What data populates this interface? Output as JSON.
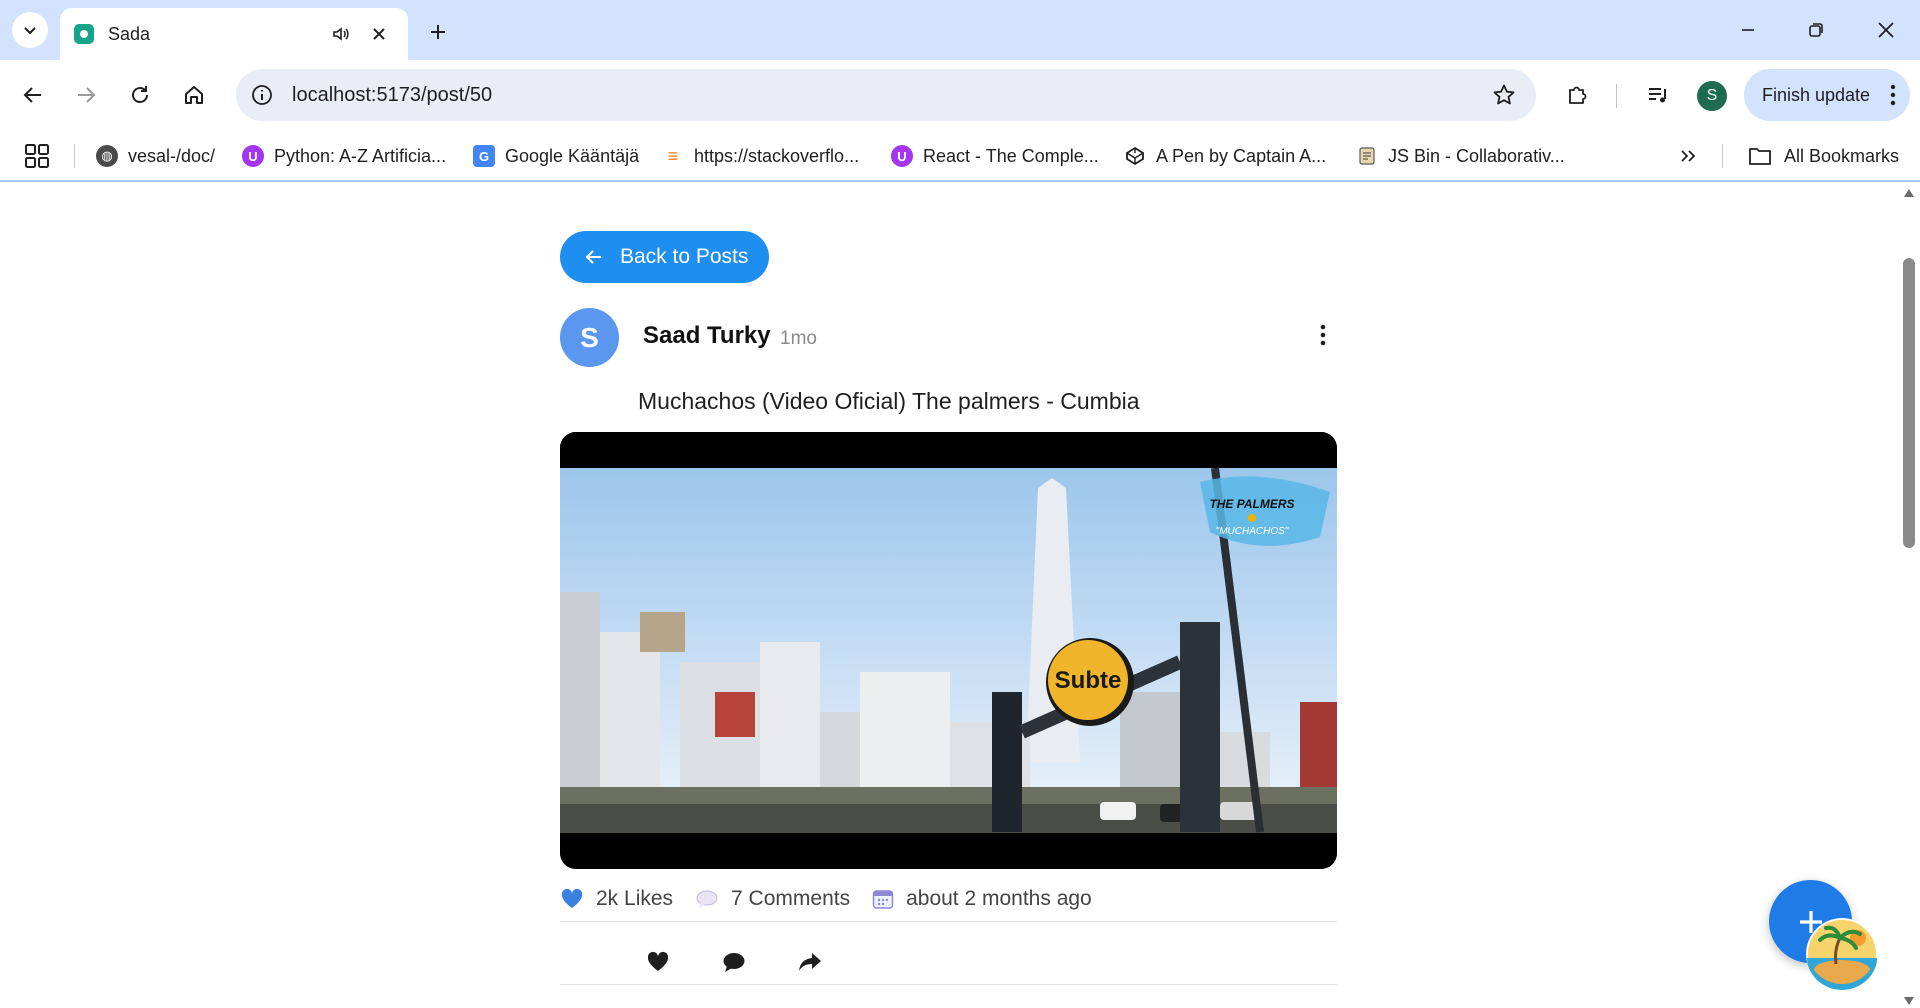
{
  "browser": {
    "tab_title": "Sada",
    "url": "localhost:5173/post/50",
    "finish_update_label": "Finish update",
    "profile_initial": "S",
    "bookmarks": [
      {
        "label": "vesal-/doc/",
        "icon": "globe-icon"
      },
      {
        "label": "Python: A-Z Artificia...",
        "icon": "udemy-icon"
      },
      {
        "label": "Google Kääntäjä",
        "icon": "google-translate-icon"
      },
      {
        "label": "https://stackoverflo...",
        "icon": "stackoverflow-icon"
      },
      {
        "label": "React - The Comple...",
        "icon": "udemy-icon"
      },
      {
        "label": "A Pen by Captain A...",
        "icon": "codepen-icon"
      },
      {
        "label": "JS Bin - Collaborativ...",
        "icon": "jsbin-icon"
      }
    ],
    "all_bookmarks_label": "All Bookmarks"
  },
  "page": {
    "back_label": "Back to Posts",
    "post": {
      "author_initial": "S",
      "author": "Saad Turky",
      "time_short": "1mo",
      "text": "Muchachos (Video Oficial) The palmers - Cumbia",
      "video_overlay_title": "THE PALMERS",
      "video_overlay_subtitle": "\"MUCHACHOS\"",
      "video_sign": "Subte",
      "likes": "2k Likes",
      "comments": "7 Comments",
      "date": "about 2 months ago"
    }
  },
  "colors": {
    "accent": "#1f8ef1",
    "avatar": "#5b96ef",
    "fab": "#1f7be6",
    "tabstrip": "#d3e3fd"
  }
}
